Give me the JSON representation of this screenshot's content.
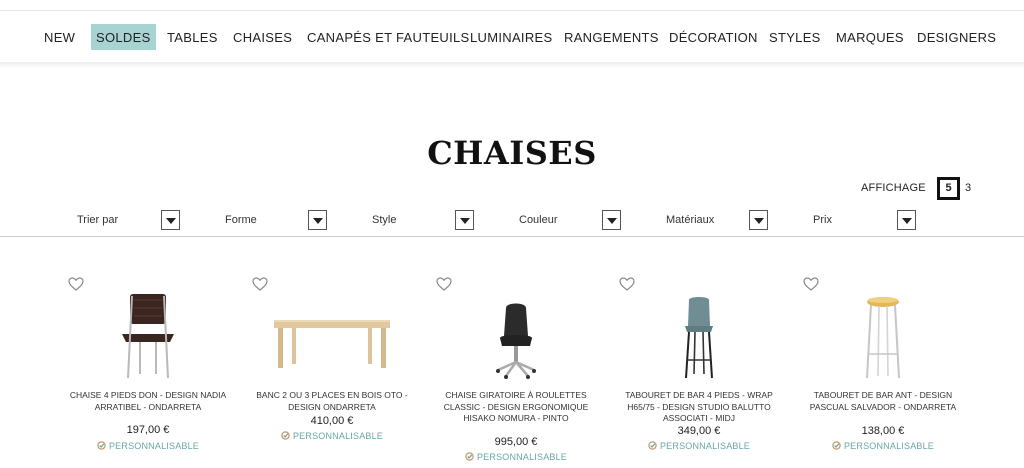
{
  "nav": {
    "items": [
      {
        "label": "NEW"
      },
      {
        "label": "SOLDES"
      },
      {
        "label": "TABLES"
      },
      {
        "label": "CHAISES"
      },
      {
        "label": "CANAPÉS ET FAUTEUILS"
      },
      {
        "label": "LUMINAIRES"
      },
      {
        "label": "RANGEMENTS"
      },
      {
        "label": "DÉCORATION"
      },
      {
        "label": "STYLES"
      },
      {
        "label": "MARQUES"
      },
      {
        "label": "DESIGNERS"
      }
    ],
    "active": "SOLDES",
    "active_color": "#a7d3d3"
  },
  "page": {
    "title": "CHAISES"
  },
  "display": {
    "label": "AFFICHAGE",
    "options": [
      "5",
      "3"
    ],
    "selected": "5"
  },
  "filters": [
    {
      "label": "Trier par"
    },
    {
      "label": "Forme"
    },
    {
      "label": "Style"
    },
    {
      "label": "Couleur"
    },
    {
      "label": "Matériaux"
    },
    {
      "label": "Prix"
    }
  ],
  "products": [
    {
      "name": "CHAISE 4 PIEDS DON - DESIGN NADIA ARRATIBEL - ONDARRETA",
      "price": "197,00 €",
      "tag": "PERSONNALISABLE",
      "image": "wooden-chair-image"
    },
    {
      "name": "BANC 2 OU 3 PLACES EN BOIS OTO - DESIGN ONDARRETA",
      "price": "410,00 €",
      "tag": "PERSONNALISABLE",
      "image": "wooden-bench-image"
    },
    {
      "name": "CHAISE GIRATOIRE À ROULETTES CLASSIC - DESIGN ERGONOMIQUE HISAKO NOMURA - PINTO",
      "price": "995,00 €",
      "tag": "PERSONNALISABLE",
      "image": "office-chair-image"
    },
    {
      "name": "TABOURET DE BAR 4 PIEDS - WRAP H65/75 - DESIGN STUDIO BALUTTO ASSOCIATI - MIDJ",
      "price": "349,00 €",
      "tag": "PERSONNALISABLE",
      "image": "bar-stool-image"
    },
    {
      "name": "TABOURET DE BAR ANT - DESIGN PASCUAL SALVADOR - ONDARRETA",
      "price": "138,00 €",
      "tag": "PERSONNALISABLE",
      "image": "round-bar-stool-image"
    }
  ],
  "colors": {
    "accent_teal": "#6aa7a7"
  }
}
